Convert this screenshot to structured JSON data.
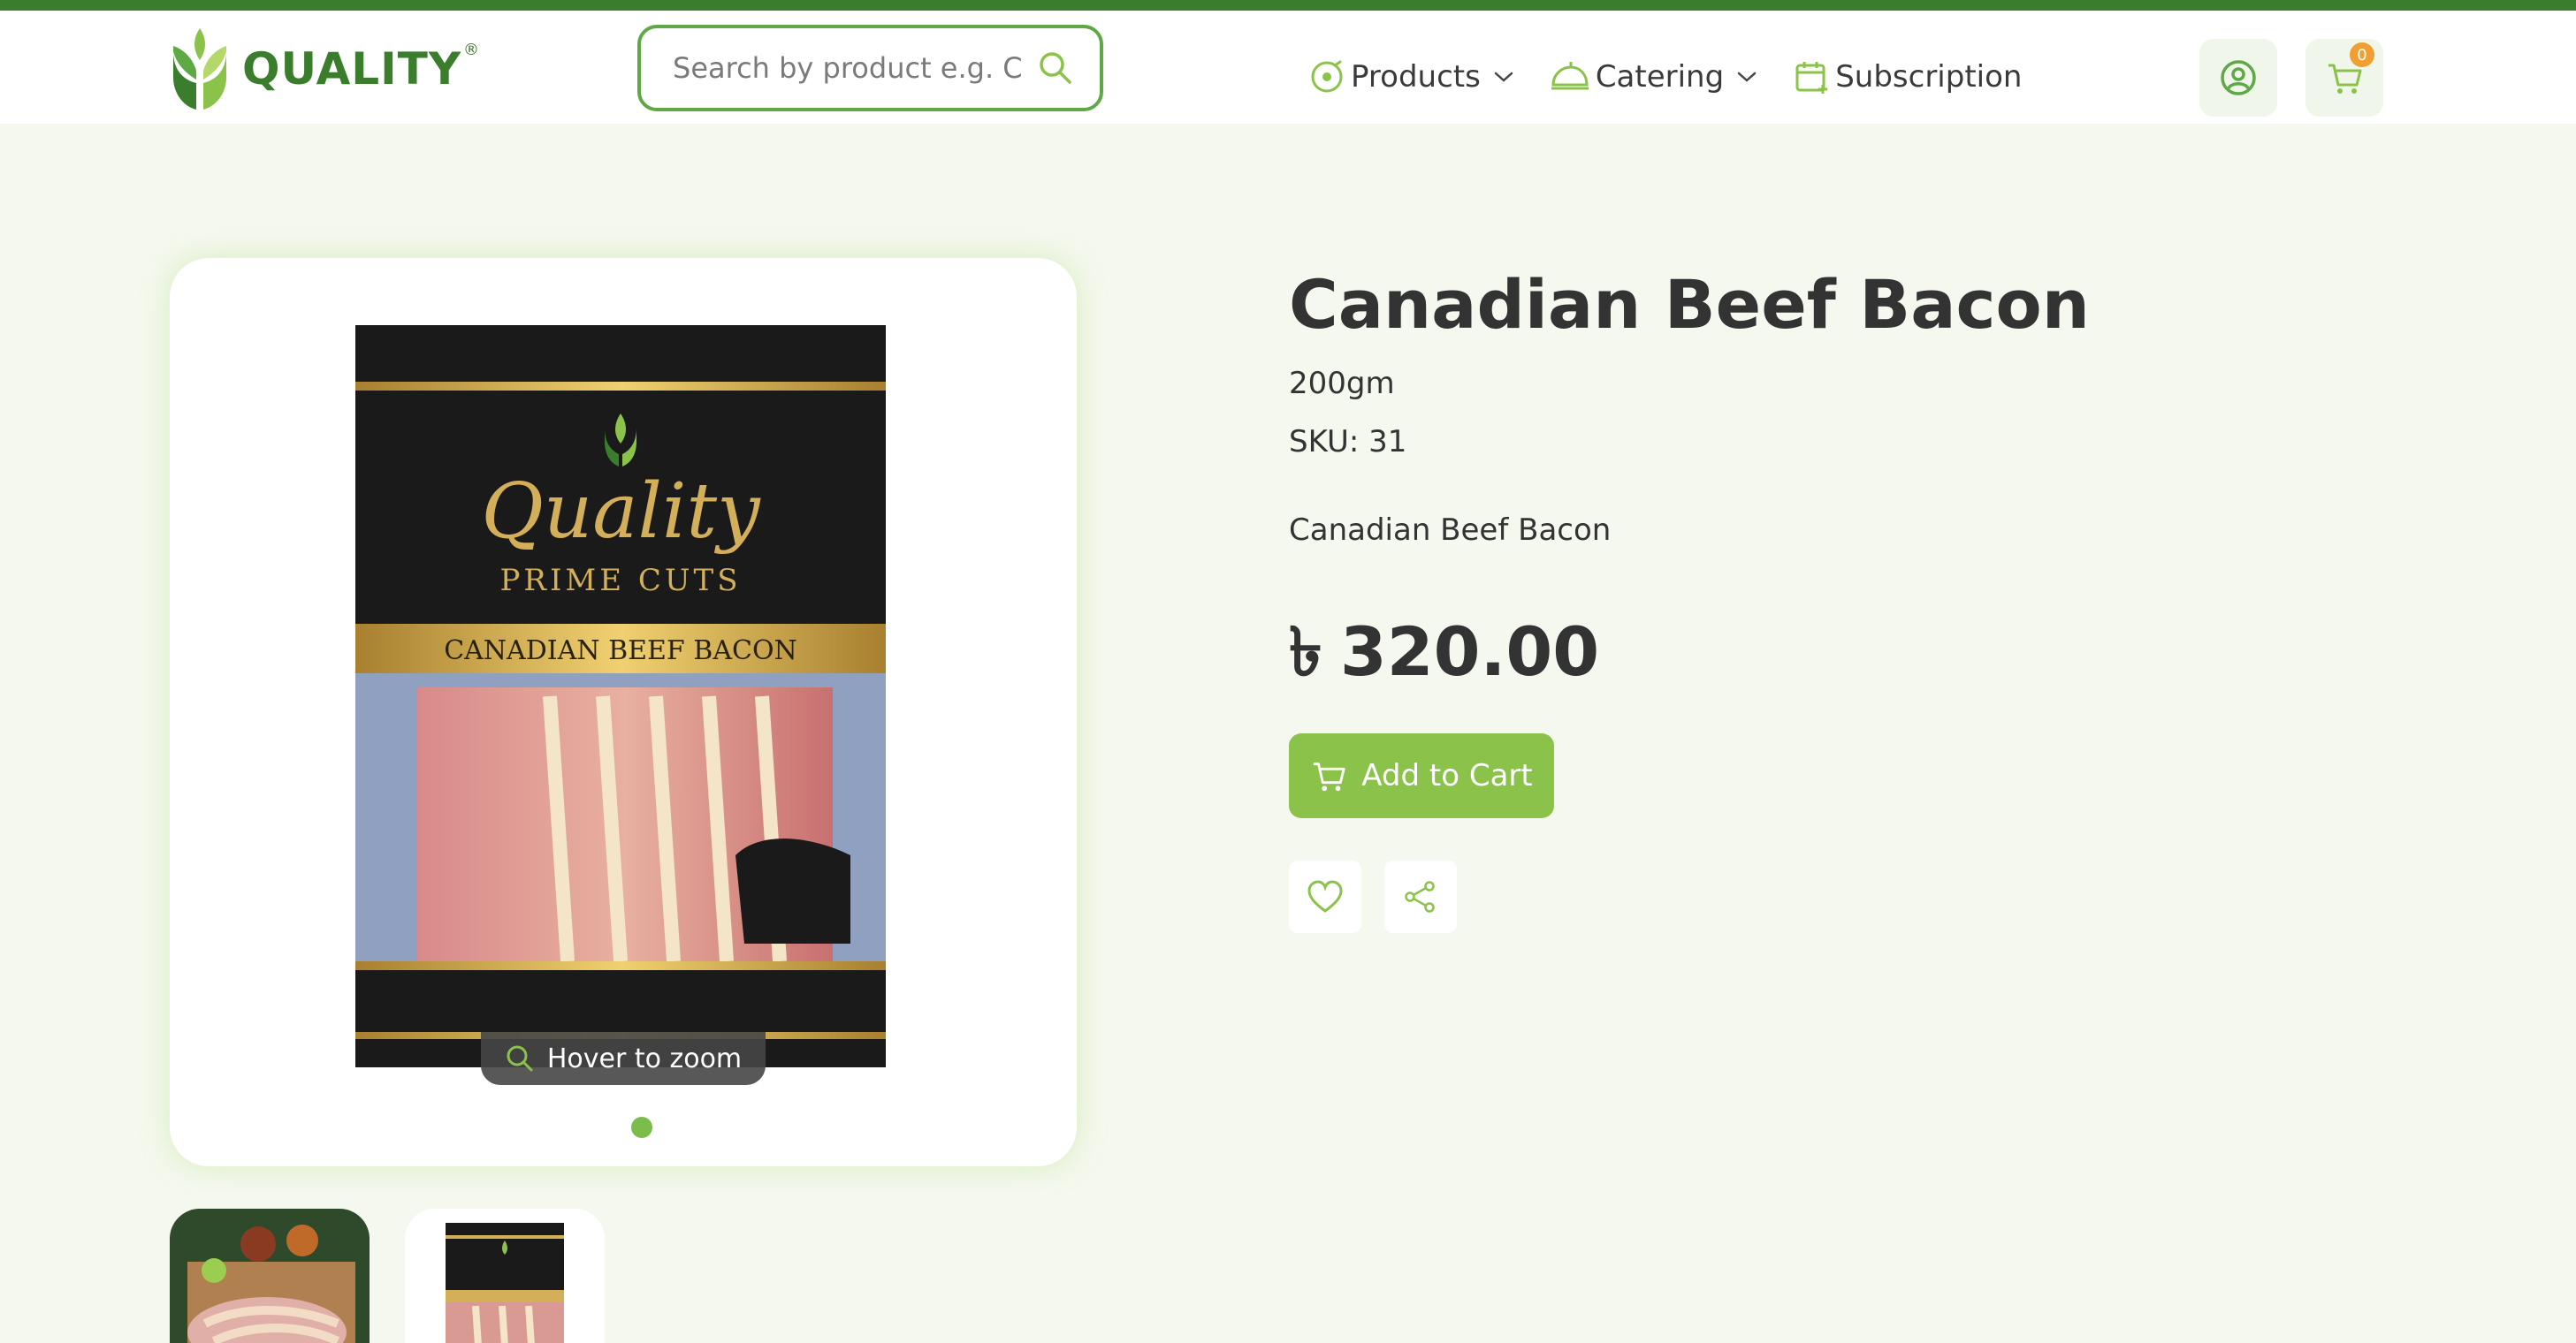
{
  "header": {
    "logo_text": "QUALITY",
    "logo_reg": "®",
    "search_placeholder": "Search by product e.g. C",
    "nav": [
      {
        "label": "Products"
      },
      {
        "label": "Catering"
      },
      {
        "label": "Subscription"
      }
    ],
    "cart_count": "0"
  },
  "gallery": {
    "zoom_hint": "Hover to zoom",
    "package_text": {
      "brand_script": "Quality",
      "line": "PRIME CUTS",
      "product": "CANADIAN BEEF BACON"
    }
  },
  "product": {
    "name": "Canadian Beef Bacon",
    "weight": "200gm",
    "sku": "SKU: 31",
    "description": "Canadian Beef Bacon",
    "currency_symbol": "৳",
    "price": "320.00",
    "add_to_cart_label": "Add to Cart"
  },
  "colors": {
    "brand_green": "#3a7d2c",
    "accent_green": "#8bc34a",
    "search_border": "#5ea845",
    "page_bg": "#f4f8ee",
    "badge": "#f0a032"
  },
  "icons": [
    "search-icon",
    "products-icon",
    "catering-icon",
    "subscription-icon",
    "user-icon",
    "cart-icon",
    "heart-icon",
    "share-icon",
    "zoom-icon"
  ]
}
